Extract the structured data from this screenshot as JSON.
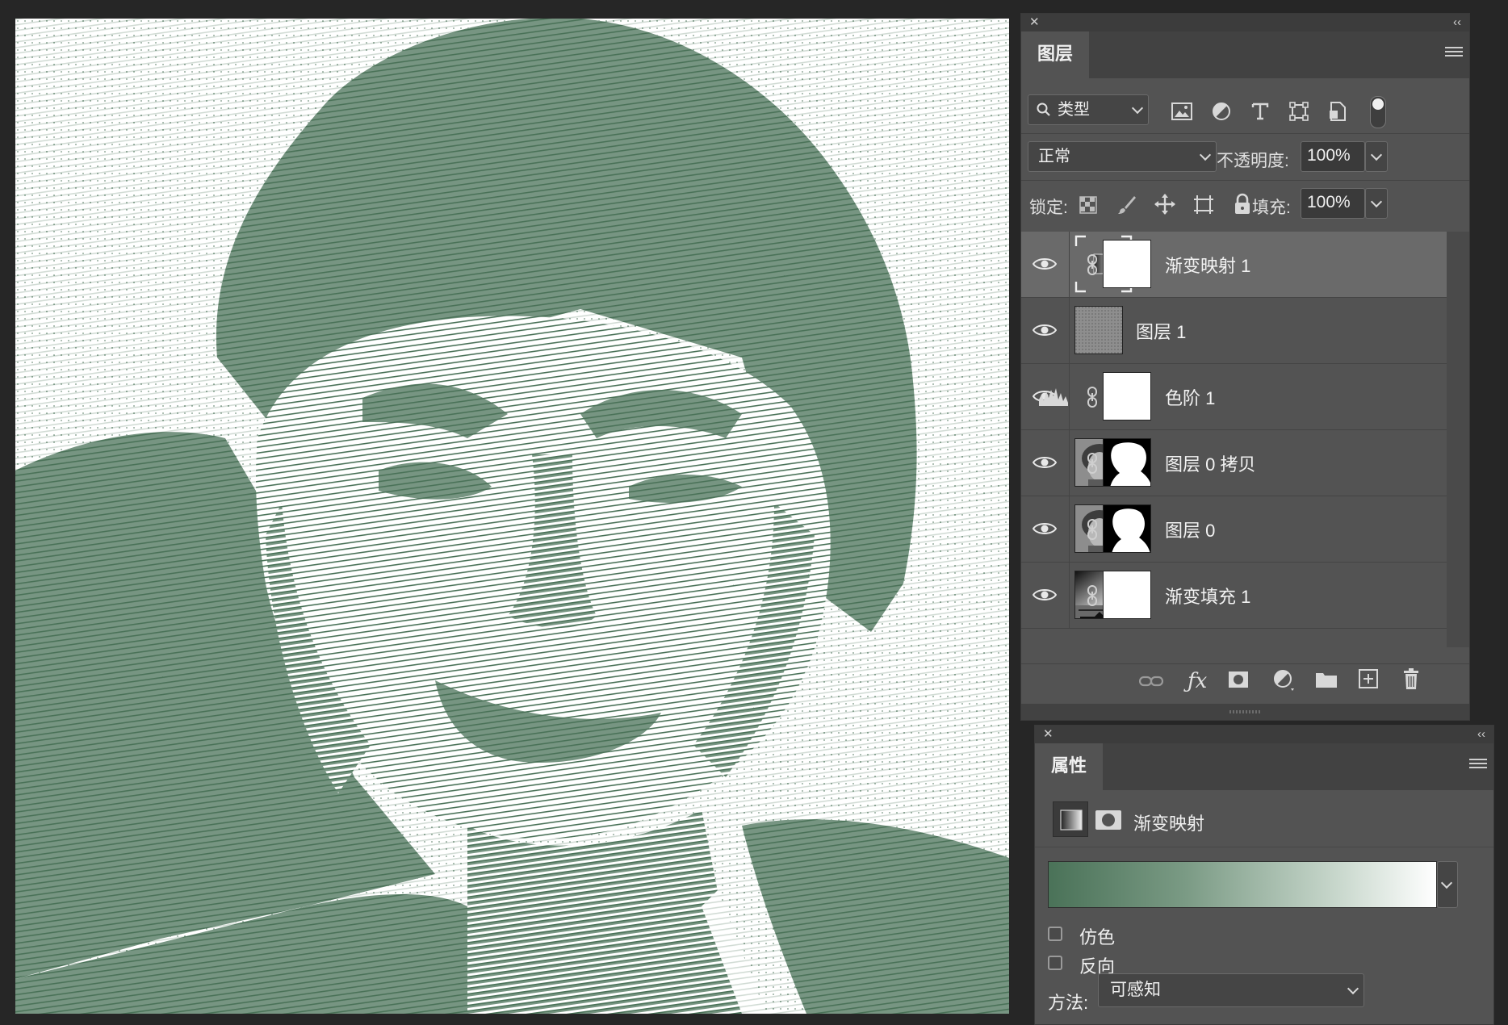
{
  "canvas": {
    "description_icon": "halftone-portrait-image",
    "ink_color": "#4a7258",
    "paper_color": "#ffffff"
  },
  "layers_panel": {
    "tab_title": "图层",
    "filter_type": "类型",
    "blend_mode": "正常",
    "opacity_label": "不透明度:",
    "opacity_value": "100%",
    "lock_label": "锁定:",
    "fill_label": "填充:",
    "fill_value": "100%",
    "layers": [
      {
        "name": "渐变映射 1",
        "kind": "gradient-map",
        "selected": true,
        "has_mask": true
      },
      {
        "name": "图层 1",
        "kind": "texture",
        "selected": false,
        "has_mask": false
      },
      {
        "name": "色阶 1",
        "kind": "levels",
        "selected": false,
        "has_mask": true
      },
      {
        "name": "图层 0 拷贝",
        "kind": "photo",
        "selected": false,
        "has_mask": true
      },
      {
        "name": "图层 0",
        "kind": "photo",
        "selected": false,
        "has_mask": true
      },
      {
        "name": "渐变填充 1",
        "kind": "gradient-fill",
        "selected": false,
        "has_mask": true
      }
    ]
  },
  "properties_panel": {
    "tab_title": "属性",
    "adjustment_name": "渐变映射",
    "gradient_from": "#4a7258",
    "gradient_to": "#ffffff",
    "dither_label": "仿色",
    "reverse_label": "反向",
    "method_label": "方法:",
    "method_value": "可感知"
  }
}
